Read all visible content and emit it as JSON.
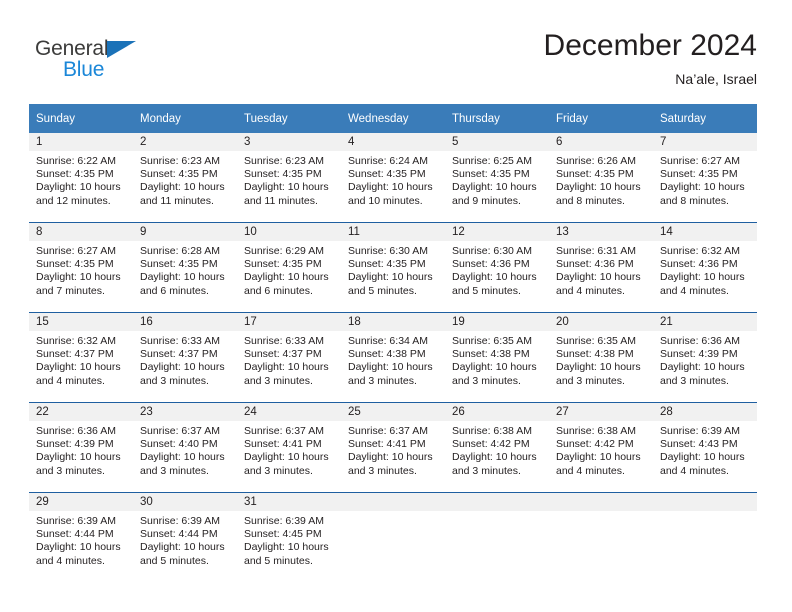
{
  "logo": {
    "word1": "General",
    "word2": "Blue",
    "triangle_color": "#1b72b8",
    "word2_color": "#1b87d8"
  },
  "header": {
    "title": "December 2024",
    "subtitle": "Na’ale, Israel"
  },
  "colors": {
    "header_blue": "#3a7cb9",
    "separator_blue": "#1f5fa0",
    "day_band_gray": "#f1f1f1",
    "text": "#231f20"
  },
  "columns": [
    "Sunday",
    "Monday",
    "Tuesday",
    "Wednesday",
    "Thursday",
    "Friday",
    "Saturday"
  ],
  "weeks": [
    [
      {
        "day": "1",
        "sunrise": "Sunrise: 6:22 AM",
        "sunset": "Sunset: 4:35 PM",
        "daylight1": "Daylight: 10 hours",
        "daylight2": "and 12 minutes."
      },
      {
        "day": "2",
        "sunrise": "Sunrise: 6:23 AM",
        "sunset": "Sunset: 4:35 PM",
        "daylight1": "Daylight: 10 hours",
        "daylight2": "and 11 minutes."
      },
      {
        "day": "3",
        "sunrise": "Sunrise: 6:23 AM",
        "sunset": "Sunset: 4:35 PM",
        "daylight1": "Daylight: 10 hours",
        "daylight2": "and 11 minutes."
      },
      {
        "day": "4",
        "sunrise": "Sunrise: 6:24 AM",
        "sunset": "Sunset: 4:35 PM",
        "daylight1": "Daylight: 10 hours",
        "daylight2": "and 10 minutes."
      },
      {
        "day": "5",
        "sunrise": "Sunrise: 6:25 AM",
        "sunset": "Sunset: 4:35 PM",
        "daylight1": "Daylight: 10 hours",
        "daylight2": "and 9 minutes."
      },
      {
        "day": "6",
        "sunrise": "Sunrise: 6:26 AM",
        "sunset": "Sunset: 4:35 PM",
        "daylight1": "Daylight: 10 hours",
        "daylight2": "and 8 minutes."
      },
      {
        "day": "7",
        "sunrise": "Sunrise: 6:27 AM",
        "sunset": "Sunset: 4:35 PM",
        "daylight1": "Daylight: 10 hours",
        "daylight2": "and 8 minutes."
      }
    ],
    [
      {
        "day": "8",
        "sunrise": "Sunrise: 6:27 AM",
        "sunset": "Sunset: 4:35 PM",
        "daylight1": "Daylight: 10 hours",
        "daylight2": "and 7 minutes."
      },
      {
        "day": "9",
        "sunrise": "Sunrise: 6:28 AM",
        "sunset": "Sunset: 4:35 PM",
        "daylight1": "Daylight: 10 hours",
        "daylight2": "and 6 minutes."
      },
      {
        "day": "10",
        "sunrise": "Sunrise: 6:29 AM",
        "sunset": "Sunset: 4:35 PM",
        "daylight1": "Daylight: 10 hours",
        "daylight2": "and 6 minutes."
      },
      {
        "day": "11",
        "sunrise": "Sunrise: 6:30 AM",
        "sunset": "Sunset: 4:35 PM",
        "daylight1": "Daylight: 10 hours",
        "daylight2": "and 5 minutes."
      },
      {
        "day": "12",
        "sunrise": "Sunrise: 6:30 AM",
        "sunset": "Sunset: 4:36 PM",
        "daylight1": "Daylight: 10 hours",
        "daylight2": "and 5 minutes."
      },
      {
        "day": "13",
        "sunrise": "Sunrise: 6:31 AM",
        "sunset": "Sunset: 4:36 PM",
        "daylight1": "Daylight: 10 hours",
        "daylight2": "and 4 minutes."
      },
      {
        "day": "14",
        "sunrise": "Sunrise: 6:32 AM",
        "sunset": "Sunset: 4:36 PM",
        "daylight1": "Daylight: 10 hours",
        "daylight2": "and 4 minutes."
      }
    ],
    [
      {
        "day": "15",
        "sunrise": "Sunrise: 6:32 AM",
        "sunset": "Sunset: 4:37 PM",
        "daylight1": "Daylight: 10 hours",
        "daylight2": "and 4 minutes."
      },
      {
        "day": "16",
        "sunrise": "Sunrise: 6:33 AM",
        "sunset": "Sunset: 4:37 PM",
        "daylight1": "Daylight: 10 hours",
        "daylight2": "and 3 minutes."
      },
      {
        "day": "17",
        "sunrise": "Sunrise: 6:33 AM",
        "sunset": "Sunset: 4:37 PM",
        "daylight1": "Daylight: 10 hours",
        "daylight2": "and 3 minutes."
      },
      {
        "day": "18",
        "sunrise": "Sunrise: 6:34 AM",
        "sunset": "Sunset: 4:38 PM",
        "daylight1": "Daylight: 10 hours",
        "daylight2": "and 3 minutes."
      },
      {
        "day": "19",
        "sunrise": "Sunrise: 6:35 AM",
        "sunset": "Sunset: 4:38 PM",
        "daylight1": "Daylight: 10 hours",
        "daylight2": "and 3 minutes."
      },
      {
        "day": "20",
        "sunrise": "Sunrise: 6:35 AM",
        "sunset": "Sunset: 4:38 PM",
        "daylight1": "Daylight: 10 hours",
        "daylight2": "and 3 minutes."
      },
      {
        "day": "21",
        "sunrise": "Sunrise: 6:36 AM",
        "sunset": "Sunset: 4:39 PM",
        "daylight1": "Daylight: 10 hours",
        "daylight2": "and 3 minutes."
      }
    ],
    [
      {
        "day": "22",
        "sunrise": "Sunrise: 6:36 AM",
        "sunset": "Sunset: 4:39 PM",
        "daylight1": "Daylight: 10 hours",
        "daylight2": "and 3 minutes."
      },
      {
        "day": "23",
        "sunrise": "Sunrise: 6:37 AM",
        "sunset": "Sunset: 4:40 PM",
        "daylight1": "Daylight: 10 hours",
        "daylight2": "and 3 minutes."
      },
      {
        "day": "24",
        "sunrise": "Sunrise: 6:37 AM",
        "sunset": "Sunset: 4:41 PM",
        "daylight1": "Daylight: 10 hours",
        "daylight2": "and 3 minutes."
      },
      {
        "day": "25",
        "sunrise": "Sunrise: 6:37 AM",
        "sunset": "Sunset: 4:41 PM",
        "daylight1": "Daylight: 10 hours",
        "daylight2": "and 3 minutes."
      },
      {
        "day": "26",
        "sunrise": "Sunrise: 6:38 AM",
        "sunset": "Sunset: 4:42 PM",
        "daylight1": "Daylight: 10 hours",
        "daylight2": "and 3 minutes."
      },
      {
        "day": "27",
        "sunrise": "Sunrise: 6:38 AM",
        "sunset": "Sunset: 4:42 PM",
        "daylight1": "Daylight: 10 hours",
        "daylight2": "and 4 minutes."
      },
      {
        "day": "28",
        "sunrise": "Sunrise: 6:39 AM",
        "sunset": "Sunset: 4:43 PM",
        "daylight1": "Daylight: 10 hours",
        "daylight2": "and 4 minutes."
      }
    ],
    [
      {
        "day": "29",
        "sunrise": "Sunrise: 6:39 AM",
        "sunset": "Sunset: 4:44 PM",
        "daylight1": "Daylight: 10 hours",
        "daylight2": "and 4 minutes."
      },
      {
        "day": "30",
        "sunrise": "Sunrise: 6:39 AM",
        "sunset": "Sunset: 4:44 PM",
        "daylight1": "Daylight: 10 hours",
        "daylight2": "and 5 minutes."
      },
      {
        "day": "31",
        "sunrise": "Sunrise: 6:39 AM",
        "sunset": "Sunset: 4:45 PM",
        "daylight1": "Daylight: 10 hours",
        "daylight2": "and 5 minutes."
      },
      {
        "day": "",
        "sunrise": "",
        "sunset": "",
        "daylight1": "",
        "daylight2": ""
      },
      {
        "day": "",
        "sunrise": "",
        "sunset": "",
        "daylight1": "",
        "daylight2": ""
      },
      {
        "day": "",
        "sunrise": "",
        "sunset": "",
        "daylight1": "",
        "daylight2": ""
      },
      {
        "day": "",
        "sunrise": "",
        "sunset": "",
        "daylight1": "",
        "daylight2": ""
      }
    ]
  ]
}
